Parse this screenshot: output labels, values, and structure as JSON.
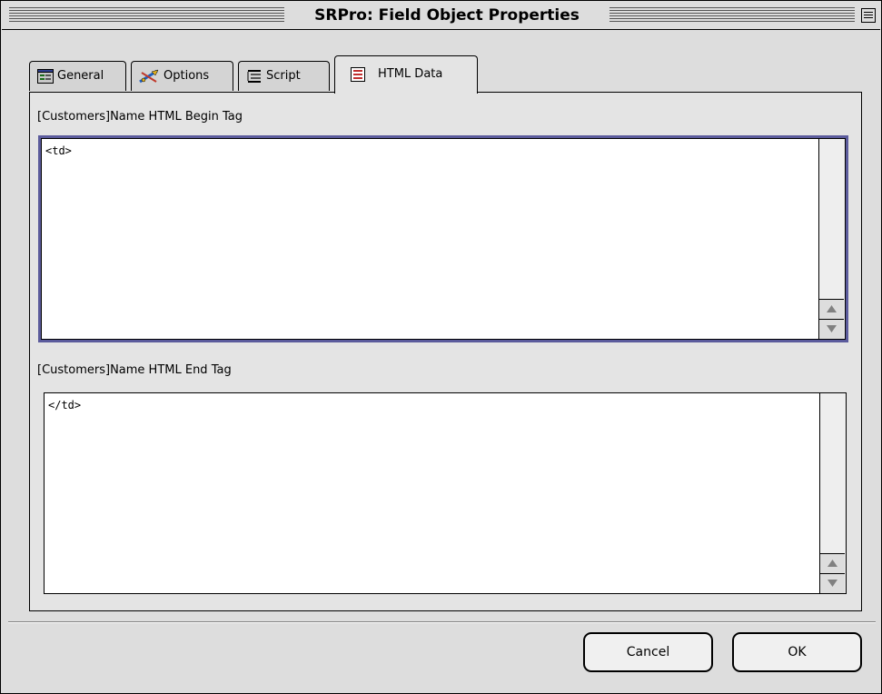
{
  "window": {
    "title": "SRPro: Field Object Properties"
  },
  "tabs": [
    {
      "label": "General",
      "icon": "general-icon",
      "active": false
    },
    {
      "label": "Options",
      "icon": "options-icon",
      "active": false
    },
    {
      "label": "Script",
      "icon": "script-icon",
      "active": false
    },
    {
      "label": "HTML Data",
      "icon": "html-data-icon",
      "active": true
    }
  ],
  "fields": {
    "begin_tag": {
      "label": "[Customers]Name HTML Begin Tag",
      "value": "<td>"
    },
    "end_tag": {
      "label": "[Customers]Name HTML End Tag",
      "value": "</td>"
    }
  },
  "buttons": {
    "cancel": "Cancel",
    "ok": "OK"
  },
  "colors": {
    "window_bg": "#dddddd",
    "panel_bg": "#e4e4e4",
    "focus_ring": "#5b5b9c"
  }
}
